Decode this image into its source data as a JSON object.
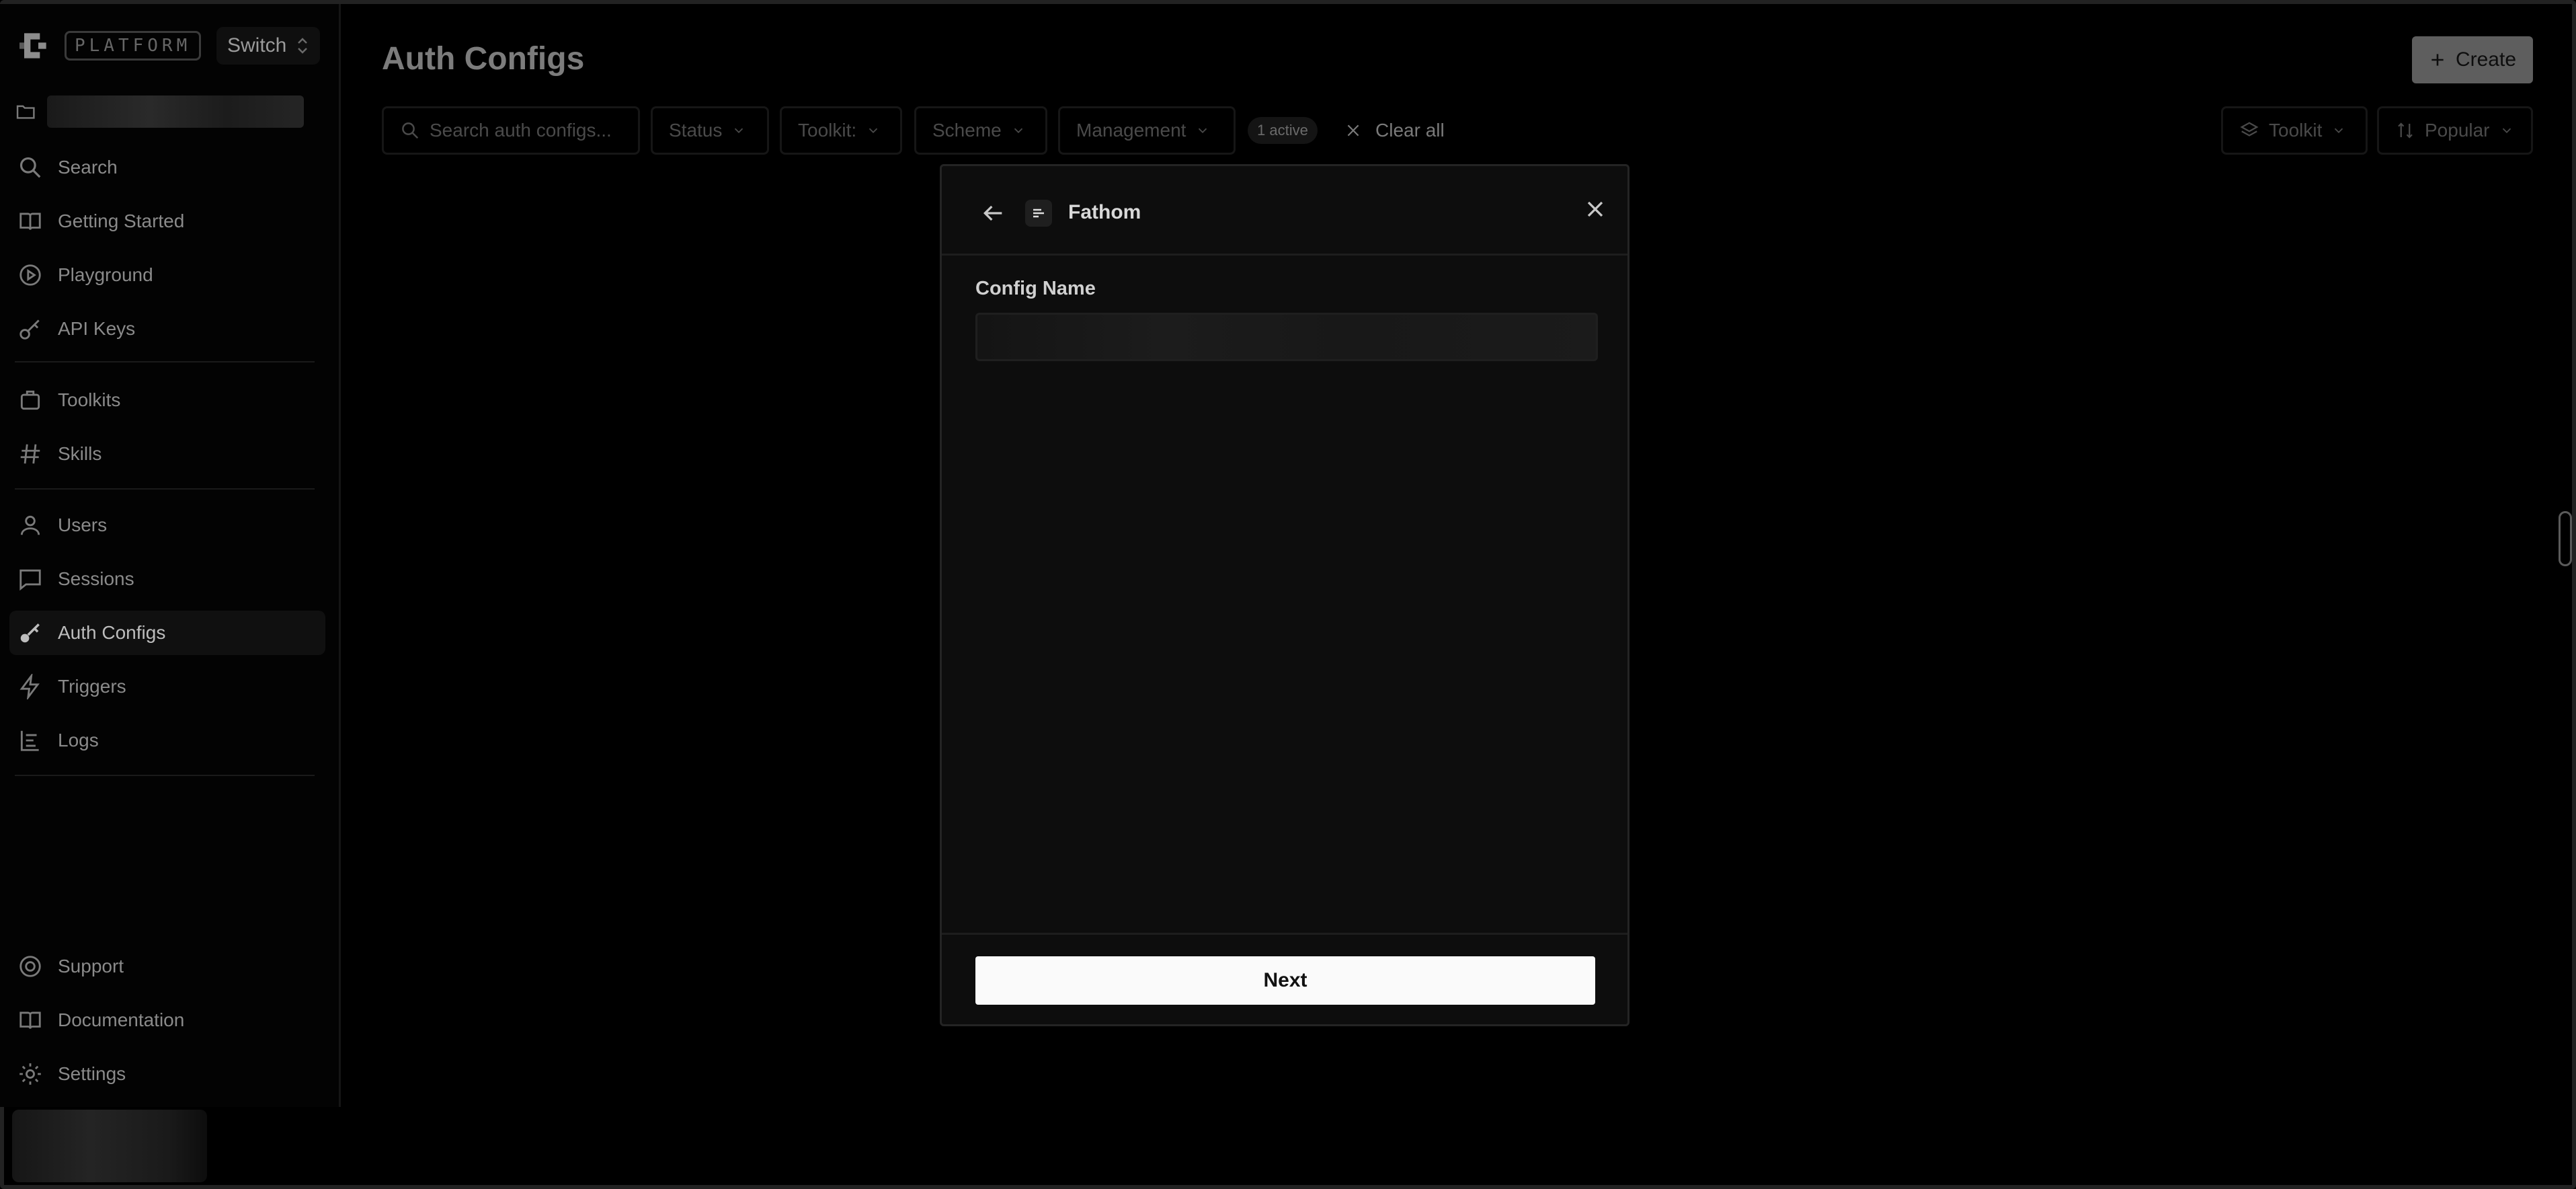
{
  "brand": {
    "badge": "PLATFORM",
    "switch_label": "Switch"
  },
  "sidebar": {
    "items": [
      {
        "label": "Search",
        "icon": "search-icon"
      },
      {
        "label": "Getting Started",
        "icon": "book-icon"
      },
      {
        "label": "Playground",
        "icon": "play-circle-icon"
      },
      {
        "label": "API Keys",
        "icon": "key-icon"
      },
      {
        "label": "Toolkits",
        "icon": "toolkit-icon"
      },
      {
        "label": "Skills",
        "icon": "hash-icon"
      },
      {
        "label": "Users",
        "icon": "user-icon"
      },
      {
        "label": "Sessions",
        "icon": "chat-icon"
      },
      {
        "label": "Auth Configs",
        "icon": "key-icon",
        "active": true
      },
      {
        "label": "Triggers",
        "icon": "bolt-icon"
      },
      {
        "label": "Logs",
        "icon": "logs-icon"
      }
    ],
    "bottom_items": [
      {
        "label": "Support",
        "icon": "support-icon"
      },
      {
        "label": "Documentation",
        "icon": "book-icon"
      },
      {
        "label": "Settings",
        "icon": "gear-icon"
      }
    ]
  },
  "page": {
    "title": "Auth Configs",
    "create_label": "Create"
  },
  "filters": {
    "search_placeholder": "Search auth configs...",
    "status": "Status",
    "toolkit": "Toolkit:",
    "scheme": "Scheme",
    "management": "Management",
    "active_badge": "1 active",
    "clear_all": "Clear all",
    "toolkit_view": "Toolkit",
    "sort": "Popular"
  },
  "modal": {
    "title": "Fathom",
    "field_label": "Config Name",
    "field_value": "",
    "next_label": "Next"
  }
}
